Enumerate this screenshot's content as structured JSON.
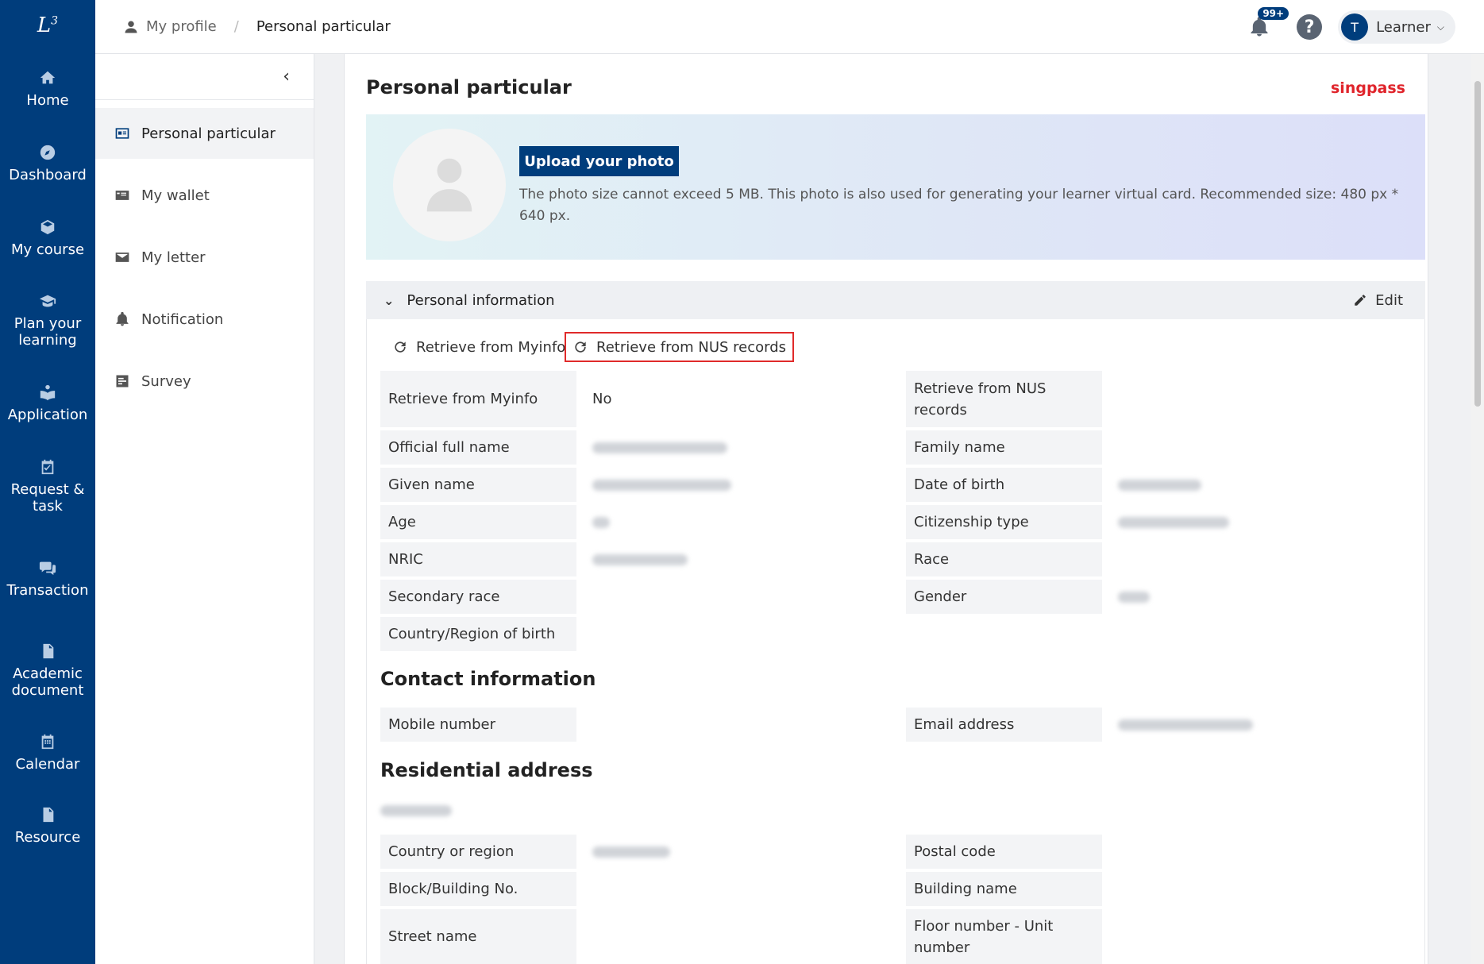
{
  "leftnav": {
    "items": [
      {
        "label": "Home",
        "icon": "home-icon"
      },
      {
        "label": "Dashboard",
        "icon": "compass-icon"
      },
      {
        "label": "My course",
        "icon": "cube-icon"
      },
      {
        "label": "Plan your learning",
        "icon": "graduation-cap-icon"
      },
      {
        "label": "Application",
        "icon": "reader-icon"
      },
      {
        "label": "Request & task",
        "icon": "calendar-check-icon"
      },
      {
        "label": "Transaction",
        "icon": "money-chat-icon"
      },
      {
        "label": "Academic document",
        "icon": "pdf-file-icon"
      },
      {
        "label": "Calendar",
        "icon": "calendar-icon"
      },
      {
        "label": "Resource",
        "icon": "file-icon"
      }
    ]
  },
  "header": {
    "breadcrumb_home": "My profile",
    "breadcrumb_sep": "/",
    "breadcrumb_current": "Personal particular",
    "notification_count": "99+",
    "help": "?",
    "user_initial": "T",
    "user_role": "Learner"
  },
  "submenu": {
    "items": [
      {
        "label": "Personal particular",
        "icon": "id-card-icon"
      },
      {
        "label": "My wallet",
        "icon": "wallet-icon"
      },
      {
        "label": "My letter",
        "icon": "envelope-icon"
      },
      {
        "label": "Notification",
        "icon": "bell-icon"
      },
      {
        "label": "Survey",
        "icon": "survey-icon"
      }
    ]
  },
  "main": {
    "title": "Personal particular",
    "singpass": "singpass",
    "upload_label": "Upload your photo",
    "photo_note": "The photo size cannot exceed 5 MB. This photo is also used for generating your learner virtual card. Recommended size: 480 px * 640 px.",
    "section_title": "Personal information",
    "edit_label": "Edit",
    "retrieve_myinfo": "Retrieve from Myinfo",
    "retrieve_nus": "Retrieve from NUS records",
    "fields": {
      "retrieve_myinfo_label": "Retrieve from Myinfo",
      "retrieve_myinfo_value": "No",
      "retrieve_nus_label": "Retrieve from NUS records",
      "official_full_name": "Official full name",
      "family_name": "Family name",
      "given_name": "Given name",
      "date_of_birth": "Date of birth",
      "age": "Age",
      "citizenship_type": "Citizenship type",
      "nric": "NRIC",
      "race": "Race",
      "secondary_race": "Secondary race",
      "gender": "Gender",
      "country_of_birth": "Country/Region of birth"
    },
    "contact_title": "Contact information",
    "contact": {
      "mobile": "Mobile number",
      "email": "Email address"
    },
    "address_title": "Residential address",
    "address": {
      "country": "Country or region",
      "postal": "Postal code",
      "block": "Block/Building No.",
      "building": "Building name",
      "street": "Street name",
      "floor": "Floor number - Unit number"
    }
  }
}
